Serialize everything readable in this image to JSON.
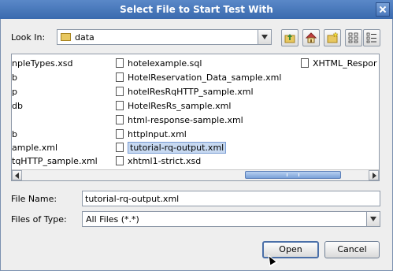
{
  "dialog": {
    "title": "Select File to Start Test With"
  },
  "look_in": {
    "label": "Look In:",
    "value": "data",
    "icon": "folder-icon"
  },
  "toolbar": {
    "buttons": [
      {
        "name": "up-one-level-button",
        "icon": "up-folder-icon"
      },
      {
        "name": "home-button",
        "icon": "home-icon"
      },
      {
        "name": "new-folder-button",
        "icon": "new-folder-icon"
      },
      {
        "name": "list-view-button",
        "icon": "list-view-icon"
      },
      {
        "name": "details-view-button",
        "icon": "details-view-icon"
      }
    ]
  },
  "files": {
    "col1": [
      "npleTypes.xsd",
      "b",
      "p",
      "db",
      "",
      "b",
      "ample.xml",
      "tqHTTP_sample.xml"
    ],
    "col2": [
      "hotelexample.sql",
      "HotelReservation_Data_sample.xml",
      "hotelResRqHTTP_sample.xml",
      "HotelResRs_sample.xml",
      "html-response-sample.xml",
      "httpInput.xml",
      "tutorial-rq-output.xml",
      "xhtml1-strict.xsd"
    ],
    "col3": [
      "XHTML_Respor"
    ],
    "selected": "tutorial-rq-output.xml"
  },
  "file_name": {
    "label": "File Name:",
    "value": "tutorial-rq-output.xml"
  },
  "file_type": {
    "label": "Files of Type:",
    "value": "All Files (*.*)"
  },
  "buttons": {
    "open": "Open",
    "cancel": "Cancel"
  },
  "colors": {
    "title_bar": "#3a6aae",
    "selection": "#c7d9f1",
    "scroll_thumb": "#7aa2d8"
  }
}
